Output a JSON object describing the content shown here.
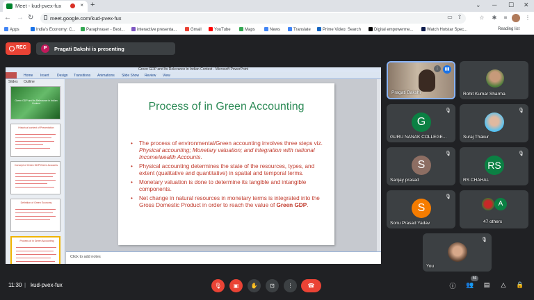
{
  "browser": {
    "tab_title": "Meet - kud-pvex-fux",
    "new_tab": "+",
    "url": "meet.google.com/kud-pvex-fux",
    "reading_list": "Reading list"
  },
  "bookmarks": [
    {
      "label": "Apps",
      "color": "#4285f4"
    },
    {
      "label": "India's Economy: C...",
      "color": "#1a73e8"
    },
    {
      "label": "Paraphraser - Best...",
      "color": "#34a853"
    },
    {
      "label": "interactive presenta...",
      "color": "#7e57c2"
    },
    {
      "label": "Gmail",
      "color": "#ea4335"
    },
    {
      "label": "YouTube",
      "color": "#ff0000"
    },
    {
      "label": "Maps",
      "color": "#34a853"
    },
    {
      "label": "News",
      "color": "#4285f4"
    },
    {
      "label": "Translate",
      "color": "#4285f4"
    },
    {
      "label": "Prime Video: Search",
      "color": "#1565c0"
    },
    {
      "label": "Digital empowerme...",
      "color": "#000000"
    },
    {
      "label": "Watch Hotstar Spec...",
      "color": "#0d1b4c"
    }
  ],
  "meet": {
    "rec_label": "REC",
    "presenter_initial": "P",
    "presenting_text": "Pragati Bakshi is presenting",
    "clock": "11:30",
    "separator": "|",
    "meeting_code": "kud-pvex-fux",
    "participant_count": "56"
  },
  "powerpoint": {
    "window_title": "Green GDP and Its Relevance in Indian Context - Microsoft PowerPoint",
    "menu": [
      "Home",
      "Insert",
      "Design",
      "Transitions",
      "Animations",
      "Slide Show",
      "Review",
      "View"
    ],
    "side_tabs": [
      "Slides",
      "Outline"
    ],
    "thumbnails": [
      {
        "num": "1",
        "title": "Green GDP and its Relevance in Indian Context"
      },
      {
        "num": "2",
        "title": "Historical context of Presentation"
      },
      {
        "num": "3",
        "title": "Concept of Green GDP/Green Accounts"
      },
      {
        "num": "4",
        "title": "Definition of Green Economy"
      },
      {
        "num": "5",
        "title": "Process of in Green Accounting"
      }
    ],
    "notes_placeholder": "Click to add notes",
    "slide": {
      "title": "Process of in Green Accounting",
      "bullet1_a": "The process of environmental/Green  accounting involves three steps viz. ",
      "bullet1_b": "Physical accounting; Monetary valuation; and integration with national Income/wealth Accounts",
      "bullet1_c": ".",
      "bullet2": "Physical accounting determines the state of the resources, types, and extent (qualitative and quantitative) in spatial and temporal terms.",
      "bullet3": "Monetary valuation is done to determine its tangible and intangible components.",
      "bullet4_a": "Net change in natural resources in monetary terms is integrated into the Gross Domestic Product in order to reach the value of ",
      "bullet4_b": "Green GDP",
      "bullet4_c": "."
    }
  },
  "participants": [
    {
      "name": "Pragati Bakshi",
      "initial": ""
    },
    {
      "name": "Rohit Kumar Sharma",
      "initial": ""
    },
    {
      "name": "GURU NANAK COLLEGE...",
      "initial": "G",
      "color": "#0b8043"
    },
    {
      "name": "Suraj Thakur",
      "initial": ""
    },
    {
      "name": "Sanjay prasad",
      "initial": "S",
      "color": "#8d6e63"
    },
    {
      "name": "RS CHAHAL",
      "initial": "RS",
      "color": "#0b8043"
    },
    {
      "name": "Sonu Prasad Yadav",
      "initial": "S",
      "color": "#f57c00"
    },
    {
      "name": "47 others",
      "initial": "A",
      "color": "#0b8043"
    },
    {
      "name": "You",
      "initial": ""
    }
  ],
  "icons": {
    "mute": "mic-off-icon",
    "camera": "camera-off-icon",
    "hand": "raise-hand-icon",
    "present": "present-icon",
    "more": "more-options-icon",
    "end": "end-call-icon",
    "info": "info-icon",
    "people": "people-icon",
    "chat": "chat-icon",
    "activities": "activities-icon",
    "host": "host-controls-icon"
  }
}
